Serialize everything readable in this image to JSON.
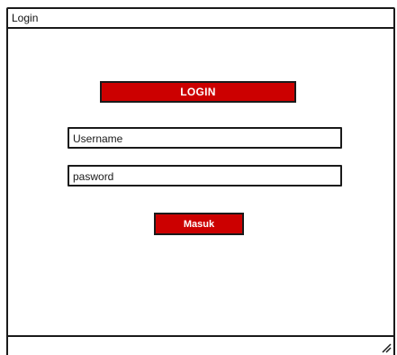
{
  "window": {
    "title": "Login"
  },
  "banner": {
    "label": "LOGIN"
  },
  "form": {
    "username_value": "Username",
    "password_value": "pasword",
    "submit_label": "Masuk"
  },
  "colors": {
    "accent": "#cc0000",
    "border": "#1a1a1a",
    "background": "#ffffff"
  },
  "icons": {
    "resize": "resize-grip-icon"
  }
}
